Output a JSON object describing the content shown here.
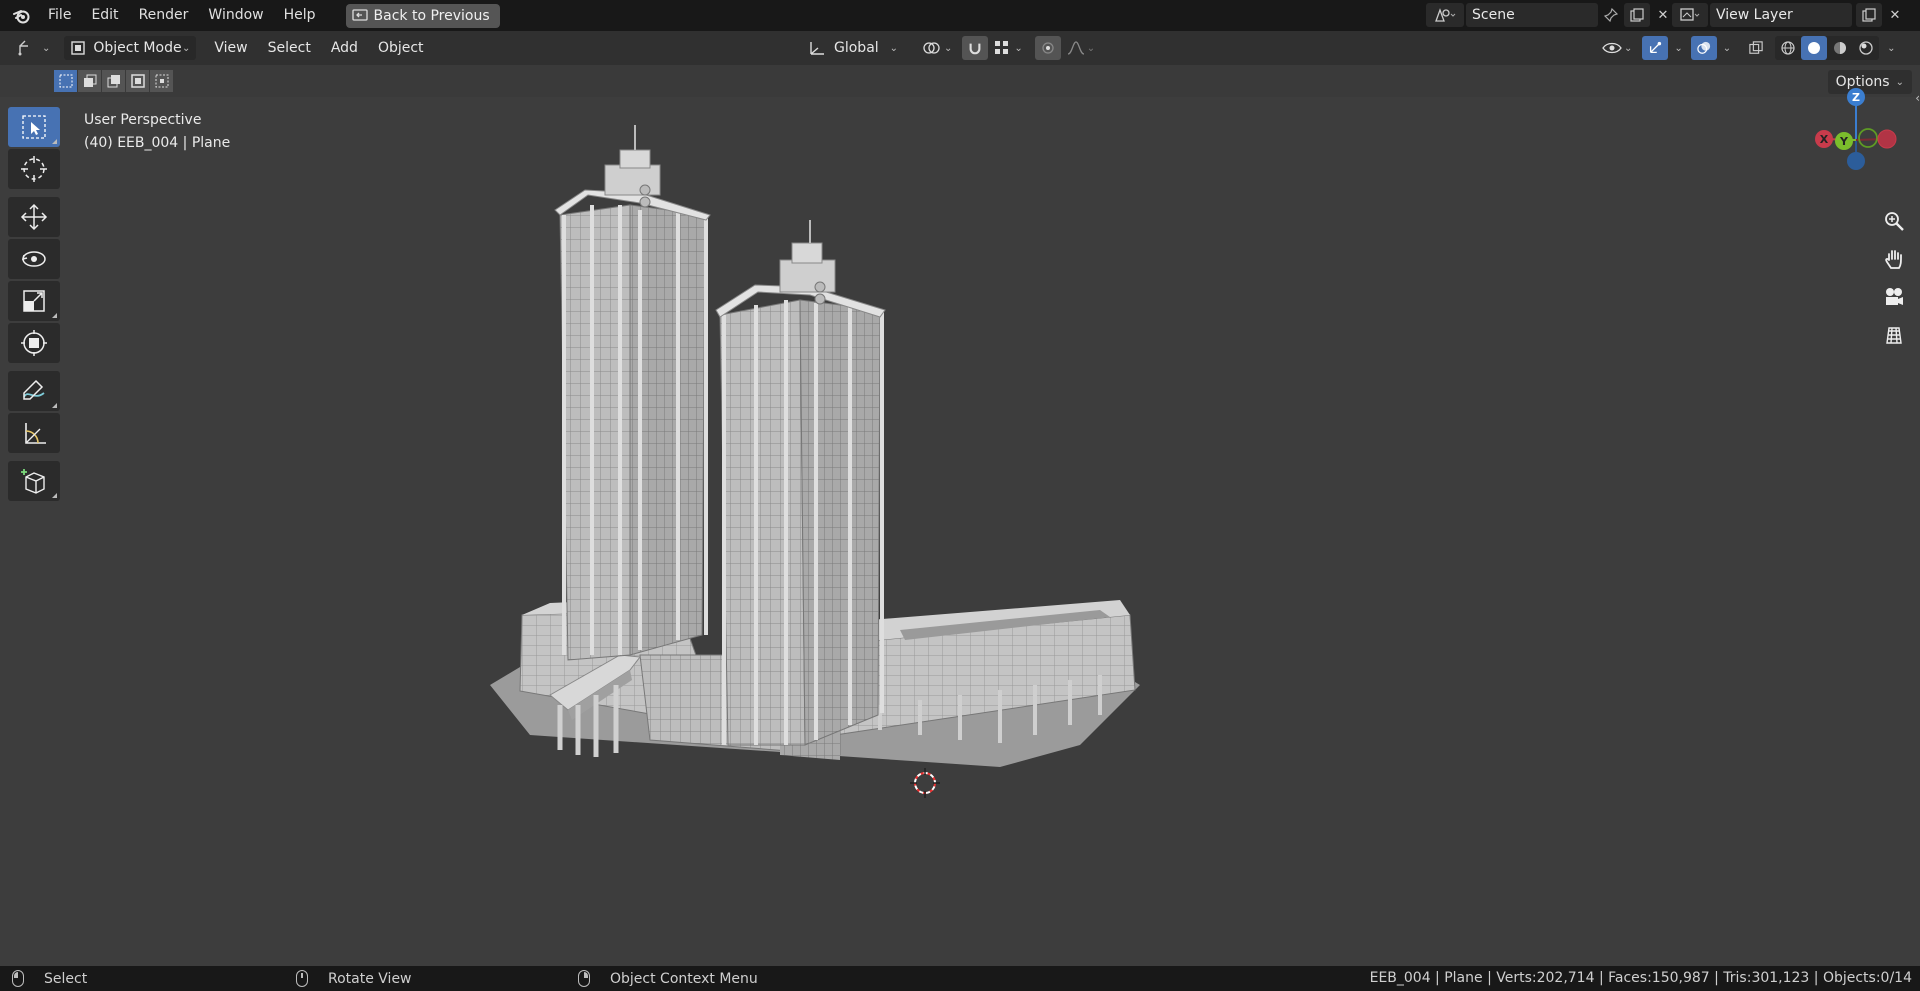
{
  "menu": {
    "items": [
      "File",
      "Edit",
      "Render",
      "Window",
      "Help"
    ],
    "back_label": "Back to Previous"
  },
  "scene": {
    "name": "Scene"
  },
  "view_layer": {
    "name": "View Layer"
  },
  "viewport_header": {
    "mode": "Object Mode",
    "menus": [
      "View",
      "Select",
      "Add",
      "Object"
    ],
    "transform_orientation": "Global"
  },
  "options_label": "Options",
  "viewport_info": {
    "perspective": "User Perspective",
    "object_info": "(40) EEB_004 | Plane"
  },
  "gizmo": {
    "z": "Z",
    "y": "Y",
    "x": "X"
  },
  "colors": {
    "accent": "#4772b3",
    "x_axis": "#c83b4b",
    "y_axis": "#7bbd2c",
    "z_axis": "#3b7ed0"
  },
  "status": {
    "select": "Select",
    "rotate": "Rotate View",
    "context": "Object Context Menu",
    "stats": "EEB_004 | Plane | Verts:202,714 | Faces:150,987 | Tris:301,123 | Objects:0/14"
  }
}
